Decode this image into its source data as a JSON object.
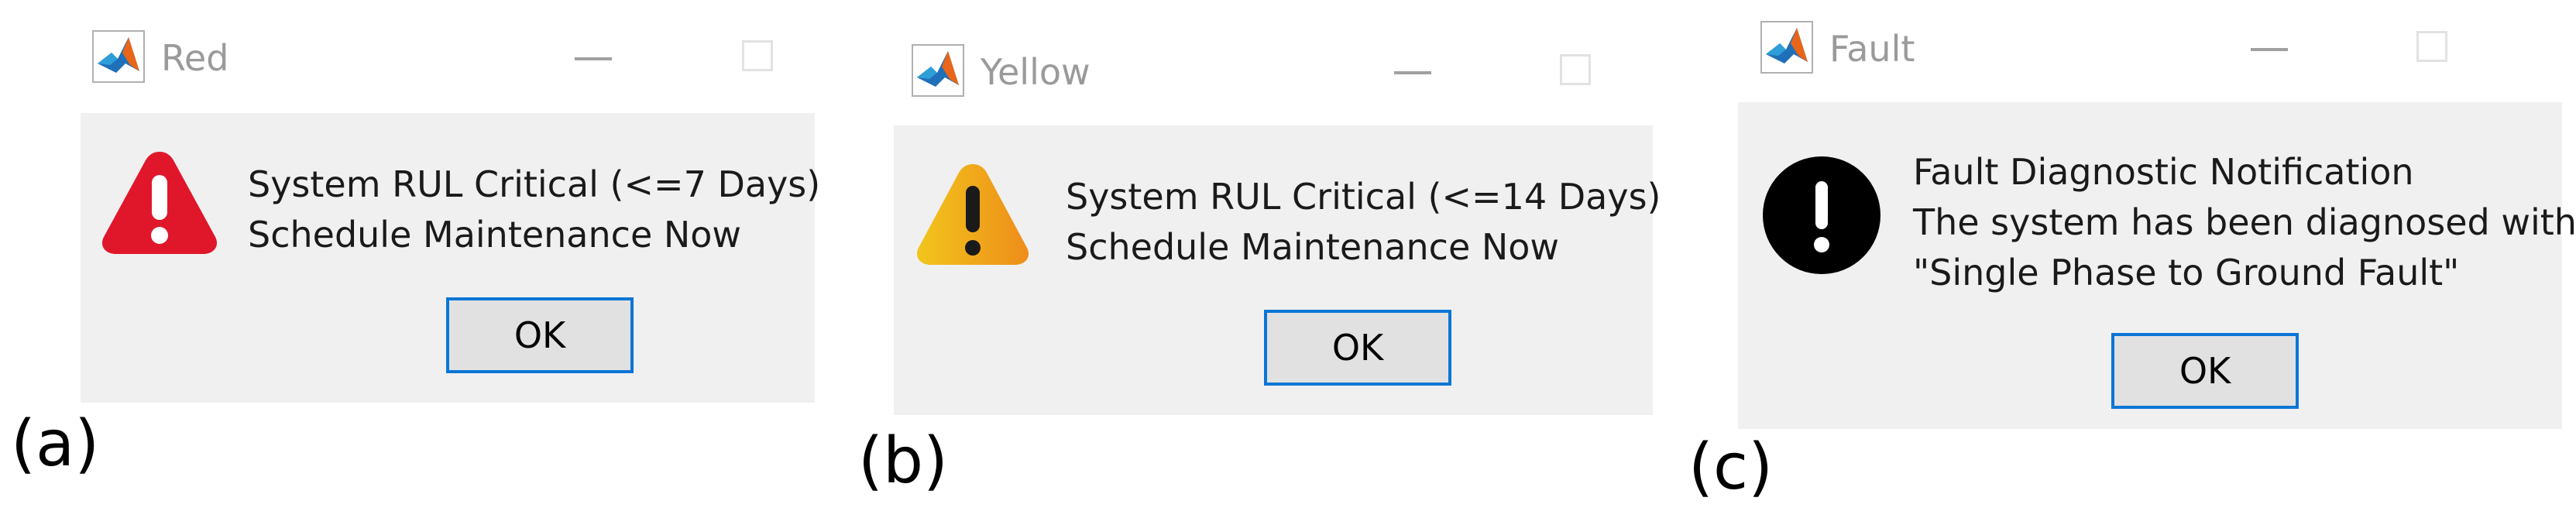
{
  "dialogs": [
    {
      "title": "Red",
      "lines": [
        "System RUL Critical (<=7 Days)",
        "Schedule Maintenance Now"
      ],
      "ok_label": "OK",
      "panel_label": "(a)",
      "icon": "red-warning-triangle",
      "icon_color": "#e0172b"
    },
    {
      "title": "Yellow",
      "lines": [
        "System RUL Critical (<=14 Days)",
        "Schedule Maintenance Now"
      ],
      "ok_label": "OK",
      "panel_label": "(b)",
      "icon": "yellow-warning-triangle",
      "icon_color": "#f0a418"
    },
    {
      "title": "Fault",
      "lines": [
        "Fault Diagnostic Notification",
        "The system has been diagnosed with",
        "\"Single Phase to Ground Fault\""
      ],
      "ok_label": "OK",
      "panel_label": "(c)",
      "icon": "black-error-circle",
      "icon_color": "#000000"
    }
  ],
  "colors": {
    "dialog_background": "#f0f0f0",
    "button_border": "#0a76d6",
    "button_fill": "#e1e1e1",
    "title_text": "#9a9a9a"
  }
}
